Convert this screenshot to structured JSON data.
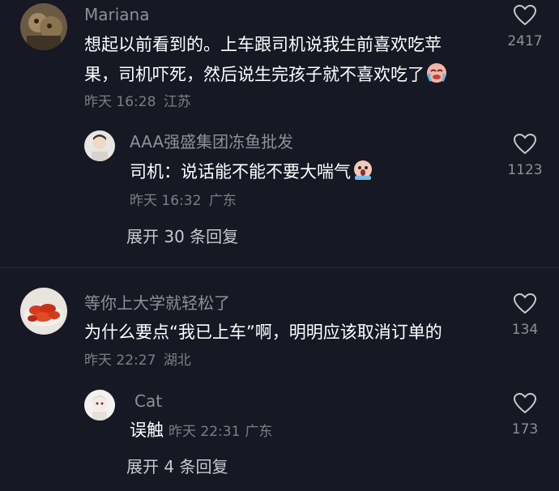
{
  "comments": [
    {
      "username": "Mariana",
      "text_lines": [
        "想起以前看到的。上车跟司机说我生前喜欢吃苹",
        "果，司机吓死，然后说生完孩子就不喜欢吃了"
      ],
      "date": "昨天 16:28",
      "location": "江苏",
      "likes": "2417",
      "reply": {
        "username": "AAA强盛集团冻鱼批发",
        "text": "司机：说话能不能不要大喘气",
        "date": "昨天 16:32",
        "location": "广东",
        "likes": "1123"
      },
      "expand_label": "展开 30 条回复"
    },
    {
      "username": "等你上大学就轻松了",
      "text": "为什么要点“我已上车”啊，明明应该取消订单的",
      "date": "昨天 22:27",
      "location": "湖北",
      "likes": "134",
      "reply": {
        "username": "Cat",
        "text": "误触",
        "date": "昨天 22:31",
        "location": "广东",
        "likes": "173"
      },
      "expand_label": "展开 4 条回复"
    }
  ],
  "icons": {
    "like": "heart-outline-icon",
    "emoji_1": "crying-laughing-emoji",
    "emoji_2": "shocked-emoji"
  },
  "colors": {
    "background": "#161823",
    "username": "#8f9096",
    "meta": "#7d7e84",
    "text": "#ffffff"
  }
}
